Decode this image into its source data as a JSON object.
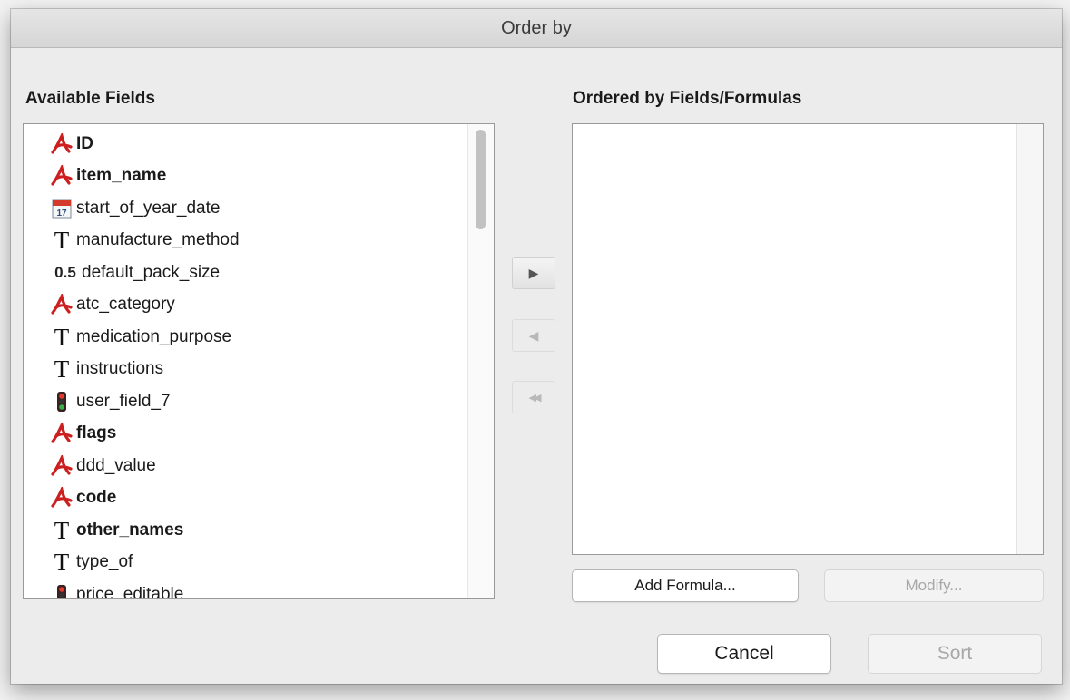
{
  "window": {
    "title": "Order by"
  },
  "available": {
    "label": "Available Fields",
    "items": [
      {
        "label": "ID",
        "icon": "alpha-field-icon",
        "bold": true
      },
      {
        "label": "item_name",
        "icon": "alpha-field-icon",
        "bold": true
      },
      {
        "label": "start_of_year_date",
        "icon": "calendar-field-icon",
        "bold": false
      },
      {
        "label": "manufacture_method",
        "icon": "text-field-icon",
        "bold": false
      },
      {
        "label": "default_pack_size",
        "icon": "number-field-icon",
        "bold": false
      },
      {
        "label": "atc_category",
        "icon": "alpha-field-icon",
        "bold": false
      },
      {
        "label": "medication_purpose",
        "icon": "text-field-icon",
        "bold": false
      },
      {
        "label": "instructions",
        "icon": "text-field-icon",
        "bold": false
      },
      {
        "label": "user_field_7",
        "icon": "boolean-field-icon",
        "bold": false
      },
      {
        "label": "flags",
        "icon": "alpha-field-icon",
        "bold": true
      },
      {
        "label": "ddd_value",
        "icon": "alpha-field-icon",
        "bold": false
      },
      {
        "label": "code",
        "icon": "alpha-field-icon",
        "bold": true
      },
      {
        "label": "other_names",
        "icon": "text-field-icon",
        "bold": true
      },
      {
        "label": "type_of",
        "icon": "text-field-icon",
        "bold": false
      },
      {
        "label": "price_editable",
        "icon": "boolean-field-icon",
        "bold": false
      }
    ],
    "icon_glyphs": {
      "text": "T",
      "number": "0.5",
      "calendar_day": "17"
    }
  },
  "ordered": {
    "label": "Ordered by Fields/Formulas"
  },
  "buttons": {
    "add_formula": "Add Formula...",
    "modify": "Modify...",
    "cancel": "Cancel",
    "sort": "Sort"
  },
  "arrows": {
    "add": "▶",
    "remove": "◀",
    "remove_all": "◀◀"
  },
  "colors": {
    "alpha_icon": "#cc1f1f",
    "calendar_header": "#d33a2c"
  }
}
